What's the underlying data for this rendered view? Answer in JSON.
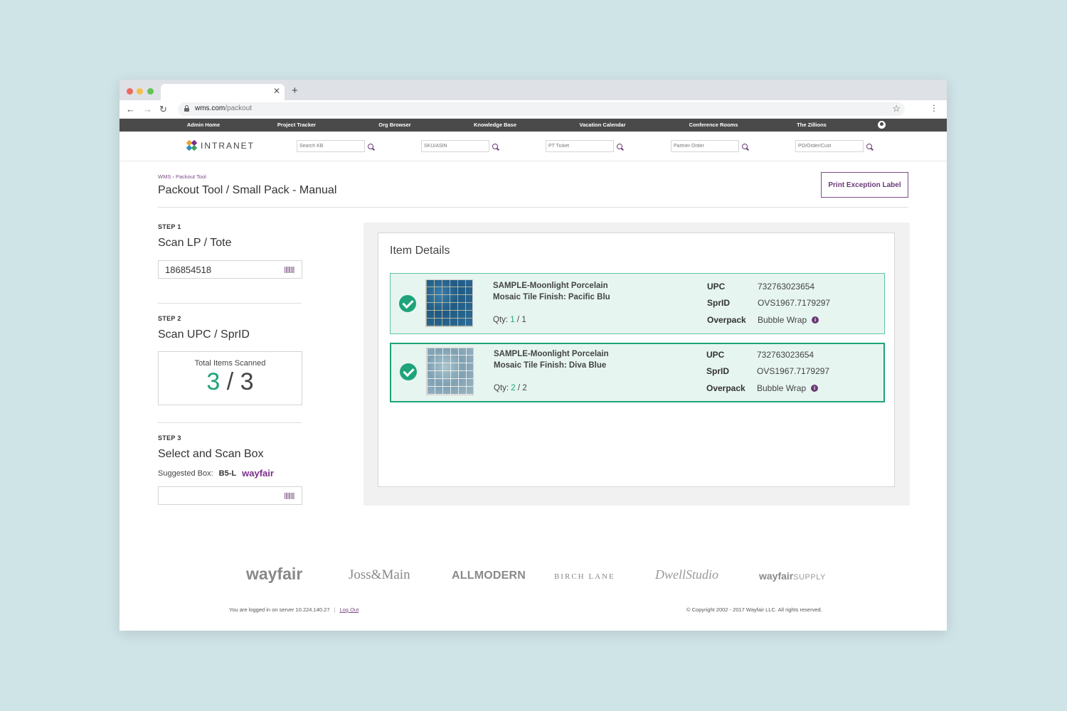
{
  "browser": {
    "url_host": "wms.com",
    "url_path": "/packout"
  },
  "topnav": [
    "Admin Home",
    "Project Tracker",
    "Org Browser",
    "Knowledge Base",
    "Vacation Calendar",
    "Conference Rooms",
    "The Zillions"
  ],
  "header": {
    "logo_text": "INTRANET",
    "searches": [
      "Search KB",
      "SKU/ASIN",
      "PT Ticket",
      "Partner Order",
      "PO/Order/Cust"
    ]
  },
  "page": {
    "breadcrumb": "WMS › Packout Tool",
    "title": "Packout Tool / Small Pack - Manual",
    "print_button": "Print Exception Label"
  },
  "step1": {
    "label": "STEP 1",
    "title": "Scan LP / Tote",
    "value": "186854518"
  },
  "step2": {
    "label": "STEP 2",
    "title": "Scan UPC / SprID",
    "total_label": "Total Items Scanned",
    "scanned": "3",
    "separator": "/",
    "total": "3"
  },
  "step3": {
    "label": "STEP 3",
    "title": "Select and Scan Box",
    "suggested_label": "Suggested Box:",
    "suggested_value": "B5-L",
    "brand": "wayfair",
    "value": ""
  },
  "items_panel": {
    "title": "Item Details",
    "items": [
      {
        "name_line1": "SAMPLE-Moonlight Porcelain",
        "name_line2": "Mosaic Tile Finish: Pacific Blu",
        "qty_label": "Qty:",
        "qty_scanned": "1",
        "qty_sep": "/",
        "qty_total": "1",
        "upc_label": "UPC",
        "upc": "732763023654",
        "sprid_label": "SprID",
        "sprid": "OVS1967.7179297",
        "overpack_label": "Overpack",
        "overpack": "Bubble Wrap"
      },
      {
        "name_line1": "SAMPLE-Moonlight Porcelain",
        "name_line2": "Mosaic Tile Finish: Diva Blue",
        "qty_label": "Qty:",
        "qty_scanned": "2",
        "qty_sep": "/",
        "qty_total": "2",
        "upc_label": "UPC",
        "upc": "732763023654",
        "sprid_label": "SprID",
        "sprid": "OVS1967.7179297",
        "overpack_label": "Overpack",
        "overpack": "Bubble Wrap"
      }
    ]
  },
  "footer": {
    "brands": [
      "wayfair",
      "Joss&Main",
      "ALLMODERN",
      "BIRCH LANE",
      "DwellStudio",
      "wayfair",
      "SUPPLY"
    ],
    "logged_in_text": "You are logged in on server 10.224.140.27",
    "separator": "|",
    "logout": "Log Out",
    "copyright": "© Copyright 2002 - 2017 Wayfair LLC. All rights reserved."
  },
  "colors": {
    "accent_purple": "#7b4c85",
    "success_green": "#1fa37a",
    "item_bg": "#e6f5ef"
  }
}
